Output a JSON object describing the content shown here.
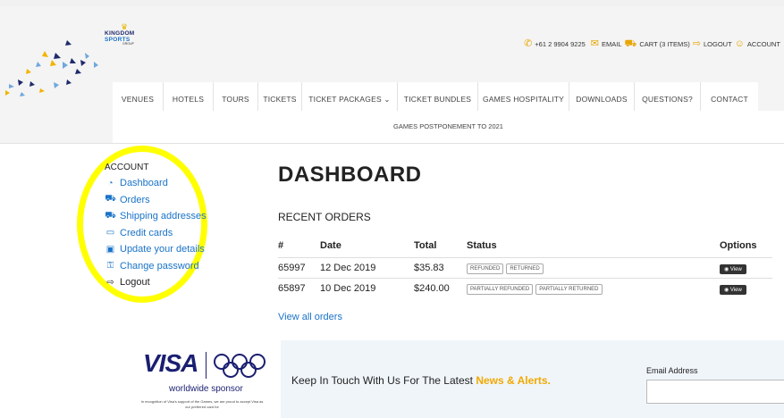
{
  "brand": {
    "name_line1": "KINGDOM",
    "name_line2": "SPORTS",
    "name_line3": "GROUP"
  },
  "topbar": {
    "phone": "+61 2 9904 9225",
    "email": "EMAIL",
    "cart": "CART (3 ITEMS)",
    "logout": "LOGOUT",
    "account": "ACCOUNT"
  },
  "nav": {
    "items": [
      "VENUES",
      "HOTELS",
      "TOURS",
      "TICKETS",
      "TICKET PACKAGES ⌄",
      "TICKET BUNDLES",
      "GAMES HOSPITALITY",
      "DOWNLOADS",
      "QUESTIONS?",
      "CONTACT"
    ]
  },
  "announcement": "GAMES POSTPONEMENT TO 2021",
  "sidebar": {
    "title": "ACCOUNT",
    "links": [
      {
        "label": "Dashboard",
        "icon": "dashboard-icon"
      },
      {
        "label": "Orders",
        "icon": "cart-icon"
      },
      {
        "label": "Shipping addresses",
        "icon": "truck-icon"
      },
      {
        "label": "Credit cards",
        "icon": "credit-card-icon"
      },
      {
        "label": "Update your details",
        "icon": "id-card-icon"
      },
      {
        "label": "Change password",
        "icon": "key-icon"
      },
      {
        "label": "Logout",
        "icon": "logout-icon"
      }
    ]
  },
  "main": {
    "title": "DASHBOARD",
    "recent_title": "RECENT ORDERS",
    "columns": [
      "#",
      "Date",
      "Total",
      "Status",
      "Options"
    ],
    "orders": [
      {
        "id": "65997",
        "date": "12 Dec 2019",
        "total": "$35.83",
        "statuses": [
          "REFUNDED",
          "RETURNED"
        ],
        "option": "View"
      },
      {
        "id": "65897",
        "date": "10 Dec 2019",
        "total": "$240.00",
        "statuses": [
          "PARTIALLY REFUNDED",
          "PARTIALLY RETURNED"
        ],
        "option": "View"
      }
    ],
    "view_all": "View all orders"
  },
  "sponsor": {
    "logo": "VISA",
    "subtitle": "worldwide sponsor",
    "note": "In recognition of Visa's support of the Games, we are proud to accept Visa as our preferred card for"
  },
  "newsletter": {
    "text": "Keep In Touch With Us For The Latest ",
    "highlight": "News & Alerts.",
    "email_label": "Email Address",
    "email_value": ""
  },
  "colors": {
    "accent": "#f2a900",
    "link": "#1a73c8",
    "highlight": "#ffff00",
    "visa_blue": "#1a1f71"
  }
}
